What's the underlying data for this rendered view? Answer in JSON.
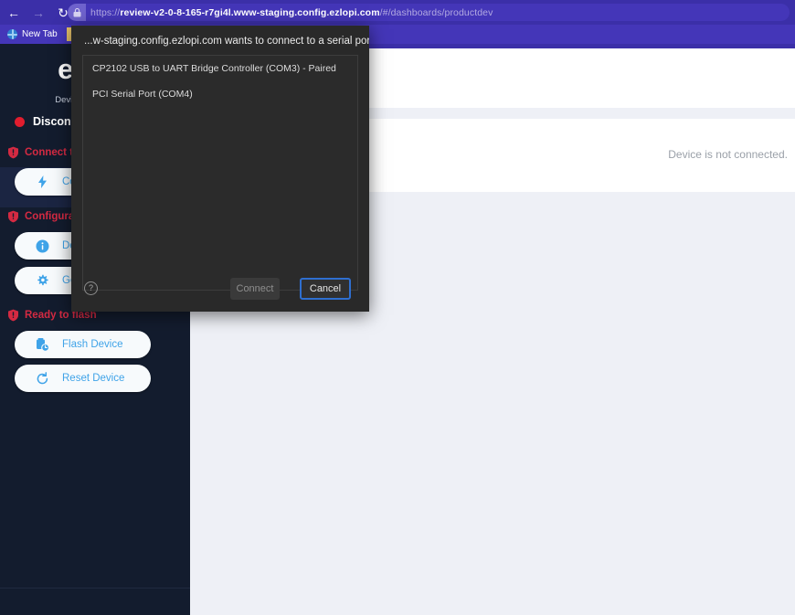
{
  "browser": {
    "nav": {
      "back_icon": "arrow-left-icon",
      "forward_icon": "arrow-right-icon",
      "reload_icon": "reload-icon",
      "back_label": "←",
      "forward_label": "→",
      "reload_label": "↻"
    },
    "omnibox": {
      "lock_icon": "lock-icon",
      "url_scheme": "https://",
      "url_host": "review-v2-0-8-165-r7gi4l.www-staging.config.ezlopi.com",
      "url_path": "/#/dashboards/productdev",
      "full_url": "https://review-v2-0-8-165-r7gi4l.www-staging.config.ezlopi.com/#/dashboards/productdev"
    },
    "tabs": [
      {
        "label": "New Tab",
        "icon": "globe-icon"
      }
    ],
    "chrome_color": "#3b2fa8",
    "tabstrip_color": "#4436b8"
  },
  "dialog": {
    "title": "...w-staging.config.ezlopi.com wants to connect to a serial port",
    "ports": [
      {
        "label": "CP2102 USB to UART Bridge Controller (COM3) - Paired"
      },
      {
        "label": "PCI Serial Port (COM4)"
      }
    ],
    "help_icon": "help-circle-icon",
    "help_label": "?",
    "connect_label": "Connect",
    "cancel_label": "Cancel",
    "background": "#292929",
    "focus_color": "#2f6fd0"
  },
  "sidebar": {
    "brand": "ezlopi",
    "subtitle": "Device Flashing Tool",
    "status": {
      "dot_color": "#e11d2e",
      "label": "Disconnected"
    },
    "sections": [
      {
        "heading": "Connect to device",
        "icon": "shield-alert-icon",
        "buttons": [
          {
            "label": "Connect Device",
            "icon": "bolt-icon"
          }
        ]
      },
      {
        "heading": "Configuration",
        "icon": "shield-alert-icon",
        "buttons": [
          {
            "label": "Device Info",
            "icon": "info-icon"
          },
          {
            "label": "General Settings",
            "icon": "gear-icon"
          }
        ]
      },
      {
        "heading": "Ready to flash",
        "icon": "shield-alert-icon",
        "buttons": [
          {
            "label": "Flash Device",
            "icon": "flash-device-icon"
          },
          {
            "label": "Reset Device",
            "icon": "reset-icon"
          }
        ]
      }
    ],
    "background": "#131c2e",
    "heading_color": "#d42a42",
    "button_text_color": "#3fa3e8"
  },
  "main": {
    "status_message": "Device is not connected.",
    "accent_bar_color": "#3b2fa8",
    "background": "#eef0f6"
  }
}
